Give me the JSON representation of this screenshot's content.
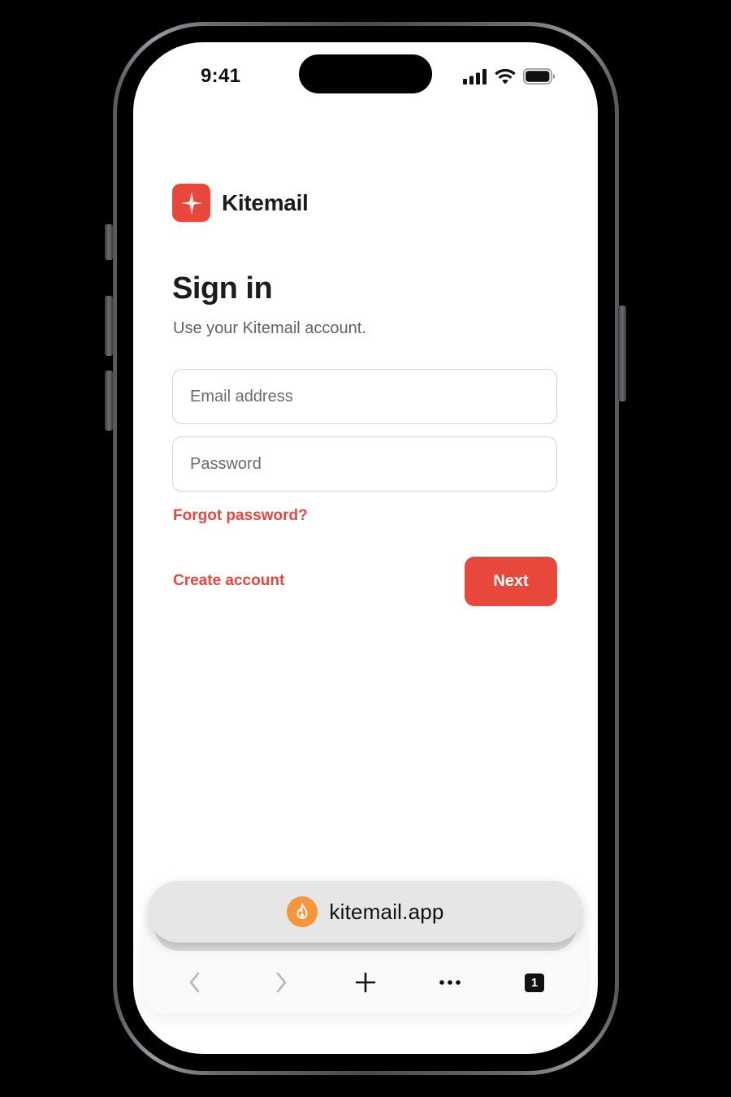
{
  "status_bar": {
    "time": "9:41",
    "icons": [
      "cellular-signal-icon",
      "wifi-icon",
      "battery-icon"
    ]
  },
  "brand": {
    "name": "Kitemail",
    "logo_icon": "kite-logo-icon",
    "color": "#e8473c"
  },
  "signin": {
    "title": "Sign in",
    "subtitle": "Use your Kitemail account.",
    "email_placeholder": "Email address",
    "email_value": "",
    "password_placeholder": "Password",
    "password_value": "",
    "forgot_label": "Forgot password?",
    "create_account_label": "Create account",
    "next_label": "Next"
  },
  "browser": {
    "url": "kitemail.app",
    "site_icon": "flame-icon",
    "site_icon_color": "#f5963a",
    "toolbar": {
      "back_icon": "chevron-left-icon",
      "forward_icon": "chevron-right-icon",
      "new_tab_icon": "plus-icon",
      "more_icon": "more-dots-icon",
      "tab_count": "1"
    }
  }
}
